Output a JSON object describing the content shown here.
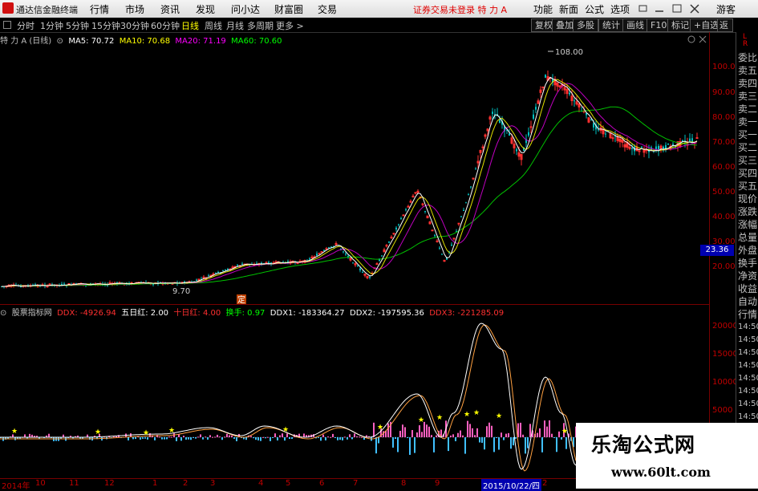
{
  "app": {
    "name": "通达信金融终端",
    "menus": [
      "行情",
      "市场",
      "资讯",
      "发现",
      "问小达",
      "财富圈",
      "交易"
    ],
    "warning": "证券交易未登录  特 力 A",
    "title_buttons": [
      "功能",
      "新面",
      "公式",
      "选项",
      "游客"
    ]
  },
  "period_toolbar": {
    "periods": [
      "分时",
      "1分钟",
      "5分钟",
      "15分钟",
      "30分钟",
      "60分钟",
      "日线",
      "周线",
      "月线",
      "多周期",
      "更多 >"
    ],
    "active": "日线",
    "right_buttons": [
      "复权",
      "叠加",
      "多股",
      "统计",
      "画线",
      "F10",
      "标记",
      "+自选",
      "返回"
    ]
  },
  "main_chart": {
    "stock_label": "特 力 A (日线)",
    "ma": [
      {
        "label": "MA5: 70.72",
        "color": "#ffffff"
      },
      {
        "label": "MA10: 70.68",
        "color": "#ffff00"
      },
      {
        "label": "MA20: 71.19",
        "color": "#ff00ff"
      },
      {
        "label": "MA60: 70.60",
        "color": "#00ff00"
      }
    ],
    "high_label": "108.00",
    "low_label": "9.70",
    "marker": "定",
    "current_price": "23.36",
    "price_ticks": [
      "100.0",
      "90.00",
      "80.00",
      "70.00",
      "60.00",
      "50.00",
      "40.00",
      "30.00",
      "20.00"
    ]
  },
  "indicator": {
    "name": "股票指标网",
    "items": [
      {
        "label": "DDX: -4926.94",
        "color": "#ff3030"
      },
      {
        "label": "五日红: 2.00",
        "color": "#ffffff"
      },
      {
        "label": "十日红: 4.00",
        "color": "#ff3030"
      },
      {
        "label": "换手: 0.97",
        "color": "#00ff00"
      },
      {
        "label": "DDX1: -183364.27",
        "color": "#ffffff"
      },
      {
        "label": "DDX2: -197595.36",
        "color": "#ffffff"
      },
      {
        "label": "DDX3: -221285.09",
        "color": "#ff3030"
      }
    ],
    "ticks": [
      "20000",
      "15000",
      "10000",
      "5000"
    ]
  },
  "right_panel": {
    "top_labels": [
      "L",
      "R"
    ],
    "items": [
      "委比",
      "卖五",
      "卖四",
      "卖三",
      "卖二",
      "卖一",
      "买一",
      "买二",
      "买三",
      "买四",
      "买五",
      "现价",
      "涨跌",
      "涨幅",
      "总量",
      "外盘",
      "换手",
      "净资",
      "收益",
      "自动",
      "行情",
      "14:50",
      "14:50",
      "14:50",
      "14:50",
      "14:50",
      "14:50",
      "14:50",
      "14:50",
      "14:50"
    ]
  },
  "date_axis": [
    "2014年",
    "10",
    "11",
    "12",
    "1",
    "2",
    "3",
    "4",
    "5",
    "6",
    "7",
    "8",
    "9",
    "2015/10/22/四",
    "2"
  ],
  "watermark": {
    "line1": "乐淘公式网",
    "line2": "www.60lt.com"
  }
}
